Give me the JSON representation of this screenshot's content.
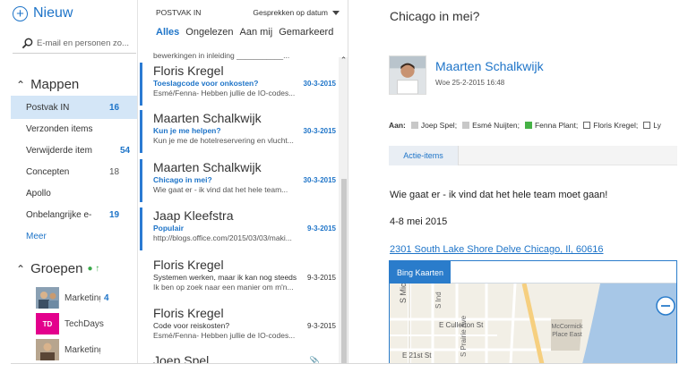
{
  "nav": {
    "new_label": "Nieuw",
    "search_placeholder": "E-mail en personen zo...",
    "folders_header": "Mappen",
    "folders": [
      {
        "label": "Postvak IN",
        "count": "16",
        "selected": true
      },
      {
        "label": "Verzonden items",
        "count": ""
      },
      {
        "label": "Verwijderde item",
        "count": "54"
      },
      {
        "label": "Concepten",
        "count": "18"
      },
      {
        "label": "Apollo",
        "count": ""
      },
      {
        "label": "Onbelangrijke e-",
        "count": "19"
      },
      {
        "label": "Meer",
        "count": ""
      }
    ],
    "groups_header": "Groepen",
    "groups": [
      {
        "label": "Marketing",
        "count": "4"
      },
      {
        "label": "TechDays",
        "count": "",
        "initials": "TD"
      },
      {
        "label": "Marketing",
        "count": ""
      }
    ]
  },
  "list": {
    "folder_name": "POSTVAK IN",
    "sort_label": "Gesprekken op datum",
    "filters": [
      "Alles",
      "Ongelezen",
      "Aan mij",
      "Gemarkeerd"
    ],
    "top_snippet": "bewerkingen in inleiding ___________...",
    "messages": [
      {
        "from": "Floris Kregel",
        "subject": "Toeslagcode voor onkosten?",
        "date": "30-3-2015",
        "preview": "Esmé/Fenna- Hebben jullie de IO-codes...",
        "unread": true
      },
      {
        "from": "Maarten Schalkwijk",
        "subject": "Kun je me helpen?",
        "date": "30-3-2015",
        "preview": "Kun je me de hotelreservering en vlucht...",
        "unread": true
      },
      {
        "from": "Maarten Schalkwijk",
        "subject": "Chicago in mei?",
        "date": "30-3-2015",
        "preview": "Wie gaat er - ik vind dat het hele team...",
        "unread": true
      },
      {
        "from": "Jaap Kleefstra",
        "subject": "Populair",
        "date": "9-3-2015",
        "preview": "http://blogs.office.com/2015/03/03/maki...",
        "unread": true
      },
      {
        "from": "Floris Kregel",
        "subject": "Systemen werken, maar ik kan nog steeds",
        "date": "9-3-2015",
        "preview": "Ik ben op zoek naar een manier om m'n...",
        "unread": false
      },
      {
        "from": "Floris Kregel",
        "subject": "Code voor reiskosten?",
        "date": "9-3-2015",
        "preview": "Esmé/Fenna- Hebben jullie de IO-codes...",
        "unread": false
      },
      {
        "from": "Joep Spel",
        "subject": "",
        "date": "",
        "preview": "",
        "unread": false
      }
    ]
  },
  "reading": {
    "title": "Chicago in mei?",
    "sender": "Maarten Schalkwijk",
    "sent": "Woe 25-2-2015 16:48",
    "to_label": "Aan:",
    "recipients": [
      {
        "name": "Joep Spel;",
        "status": "gray"
      },
      {
        "name": "Esmé Nuijten;",
        "status": "gray"
      },
      {
        "name": "Fenna Plant;",
        "status": "green"
      },
      {
        "name": "Floris Kregel;",
        "status": "empty"
      },
      {
        "name": "Ly",
        "status": "empty"
      }
    ],
    "action_tab": "Actie-items",
    "body_line1": "Wie gaat er - ik vind dat het hele team moet gaan!",
    "body_line2": "4-8 mei 2015",
    "address": "2301 South Lake Shore Delve Chicago, Il, 60616",
    "map_tab": "Bing Kaarten",
    "map_labels": [
      "S Michig",
      "S Ind",
      "E Cullerton St",
      "S Prairie Ave",
      "E 21st St",
      "McCormick Place East"
    ]
  },
  "colors": {
    "accent": "#1e74c8",
    "selected_bg": "#d4e6f7",
    "presence_green": "#46b246"
  }
}
